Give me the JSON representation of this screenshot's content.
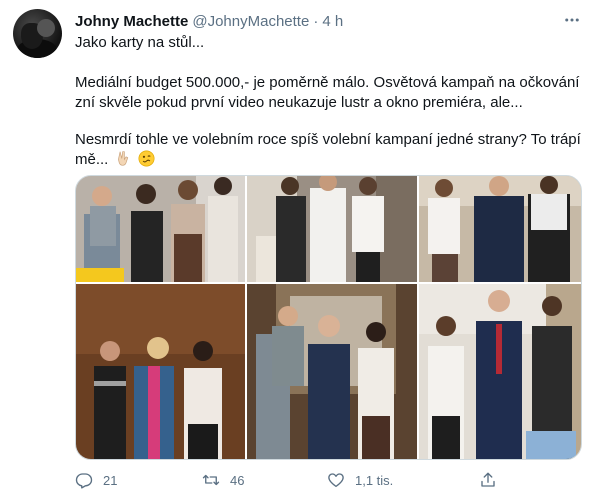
{
  "tweet": {
    "author_name": "Johny Machette",
    "author_handle": "@JohnyMachette",
    "separator": "·",
    "time": "4 h",
    "lines": [
      "Jako karty na stůl...",
      "Mediální budget 500.000,- je poměrně málo. Osvětová kampaň na očkování",
      "zní skvěle pokud první video neukazuje lustr a okno premiéra, ale...",
      "Nesmrdí tohle ve volebním roce spíš volební kampaní jedné strany? To trápí",
      "mě..."
    ],
    "emojis": [
      "victory-hand-emoji",
      "woozy-face-emoji"
    ],
    "photos": [
      {
        "name": "photo-top-left"
      },
      {
        "name": "photo-top-middle"
      },
      {
        "name": "photo-top-right"
      },
      {
        "name": "photo-bottom-left"
      },
      {
        "name": "photo-bottom-middle"
      },
      {
        "name": "photo-bottom-right"
      }
    ],
    "actions": {
      "reply_count": "21",
      "retweet_count": "46",
      "like_count": "1,1 tis."
    }
  },
  "colors": {
    "text_primary": "#0f1419",
    "text_secondary": "#5b7083",
    "border": "#cfd9de"
  },
  "icons": [
    "more-icon",
    "reply-icon",
    "retweet-icon",
    "like-icon",
    "share-icon"
  ]
}
